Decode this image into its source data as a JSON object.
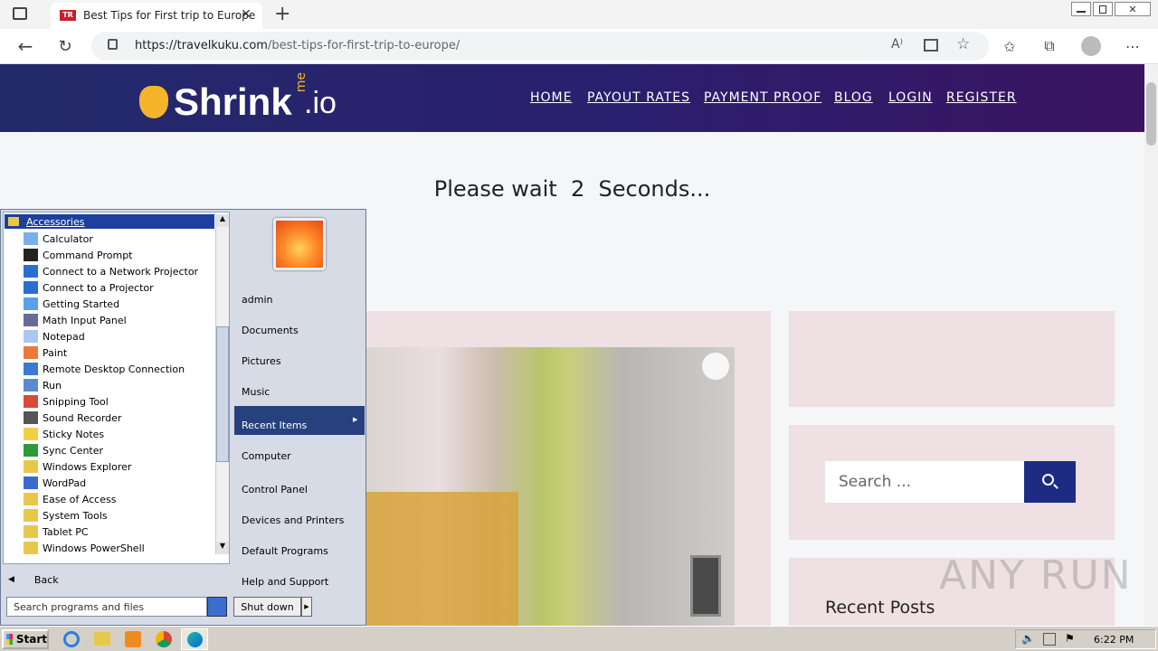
{
  "browser": {
    "tab_title": "Best Tips for First trip to Europe",
    "url_host": "https://travelkuku.com",
    "url_path": "/best-tips-for-first-trip-to-europe/",
    "tab_favicon": "TR"
  },
  "site": {
    "logo_text": "Shrink",
    "logo_me": "me",
    "logo_suffix": ".io",
    "nav": [
      "HOME",
      "PAYOUT RATES",
      "PAYMENT PROOF",
      "BLOG",
      "LOGIN",
      "REGISTER"
    ],
    "wait_prefix": "Please wait",
    "wait_count": "2",
    "wait_suffix": "Seconds...",
    "search_placeholder": "Search ...",
    "recent_posts": "Recent Posts"
  },
  "startmenu": {
    "folder": "Accessories",
    "programs": [
      "Calculator",
      "Command Prompt",
      "Connect to a Network Projector",
      "Connect to a Projector",
      "Getting Started",
      "Math Input Panel",
      "Notepad",
      "Paint",
      "Remote Desktop Connection",
      "Run",
      "Snipping Tool",
      "Sound Recorder",
      "Sticky Notes",
      "Sync Center",
      "Windows Explorer",
      "WordPad",
      "Ease of Access",
      "System Tools",
      "Tablet PC",
      "Windows PowerShell"
    ],
    "back": "Back",
    "search_placeholder": "Search programs and files",
    "right_items": [
      "admin",
      "Documents",
      "Pictures",
      "Music",
      "Recent Items",
      "Computer",
      "Control Panel",
      "Devices and Printers",
      "Default Programs",
      "Help and Support"
    ],
    "shutdown": "Shut down"
  },
  "taskbar": {
    "start": "Start",
    "time": "6:22 PM"
  },
  "watermark": "ANY RUN"
}
